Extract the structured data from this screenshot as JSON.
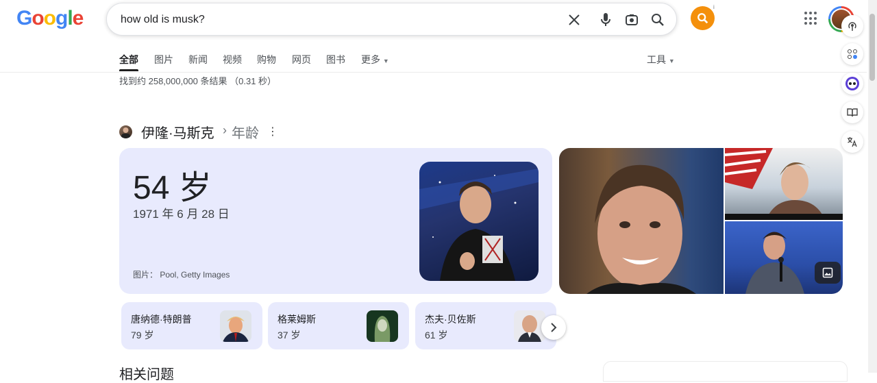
{
  "header": {
    "logo": "Google",
    "search_query": "how old is musk?",
    "info_marker": "i"
  },
  "tabs": [
    {
      "label": "全部",
      "active": true
    },
    {
      "label": "图片"
    },
    {
      "label": "新闻"
    },
    {
      "label": "视频"
    },
    {
      "label": "购物"
    },
    {
      "label": "网页"
    },
    {
      "label": "图书"
    },
    {
      "label": "更多"
    }
  ],
  "tools_label": "工具",
  "result_stats": "找到约 258,000,000 条结果 （0.31 秒）",
  "entity": {
    "name": "伊隆·马斯克",
    "separator": "›",
    "attribute": "年龄"
  },
  "answer": {
    "age": "54 岁",
    "birth_date": "1971 年 6 月 28 日",
    "image_credit": "图片： Pool, Getty Images"
  },
  "related_people": [
    {
      "name": "唐纳德·特朗普",
      "age": "79 岁"
    },
    {
      "name": "格莱姆斯",
      "age": "37 岁"
    },
    {
      "name": "杰夫·贝佐斯",
      "age": "61 岁"
    }
  ],
  "related_questions": "相关问题",
  "colors": {
    "accent_orange": "#f4900c",
    "card_bg": "#e8eafd"
  },
  "icons": {
    "clear": "close-icon",
    "voice": "microphone-icon",
    "lens": "camera-lens-icon",
    "search": "search-icon",
    "apps": "apps-grid-icon"
  }
}
